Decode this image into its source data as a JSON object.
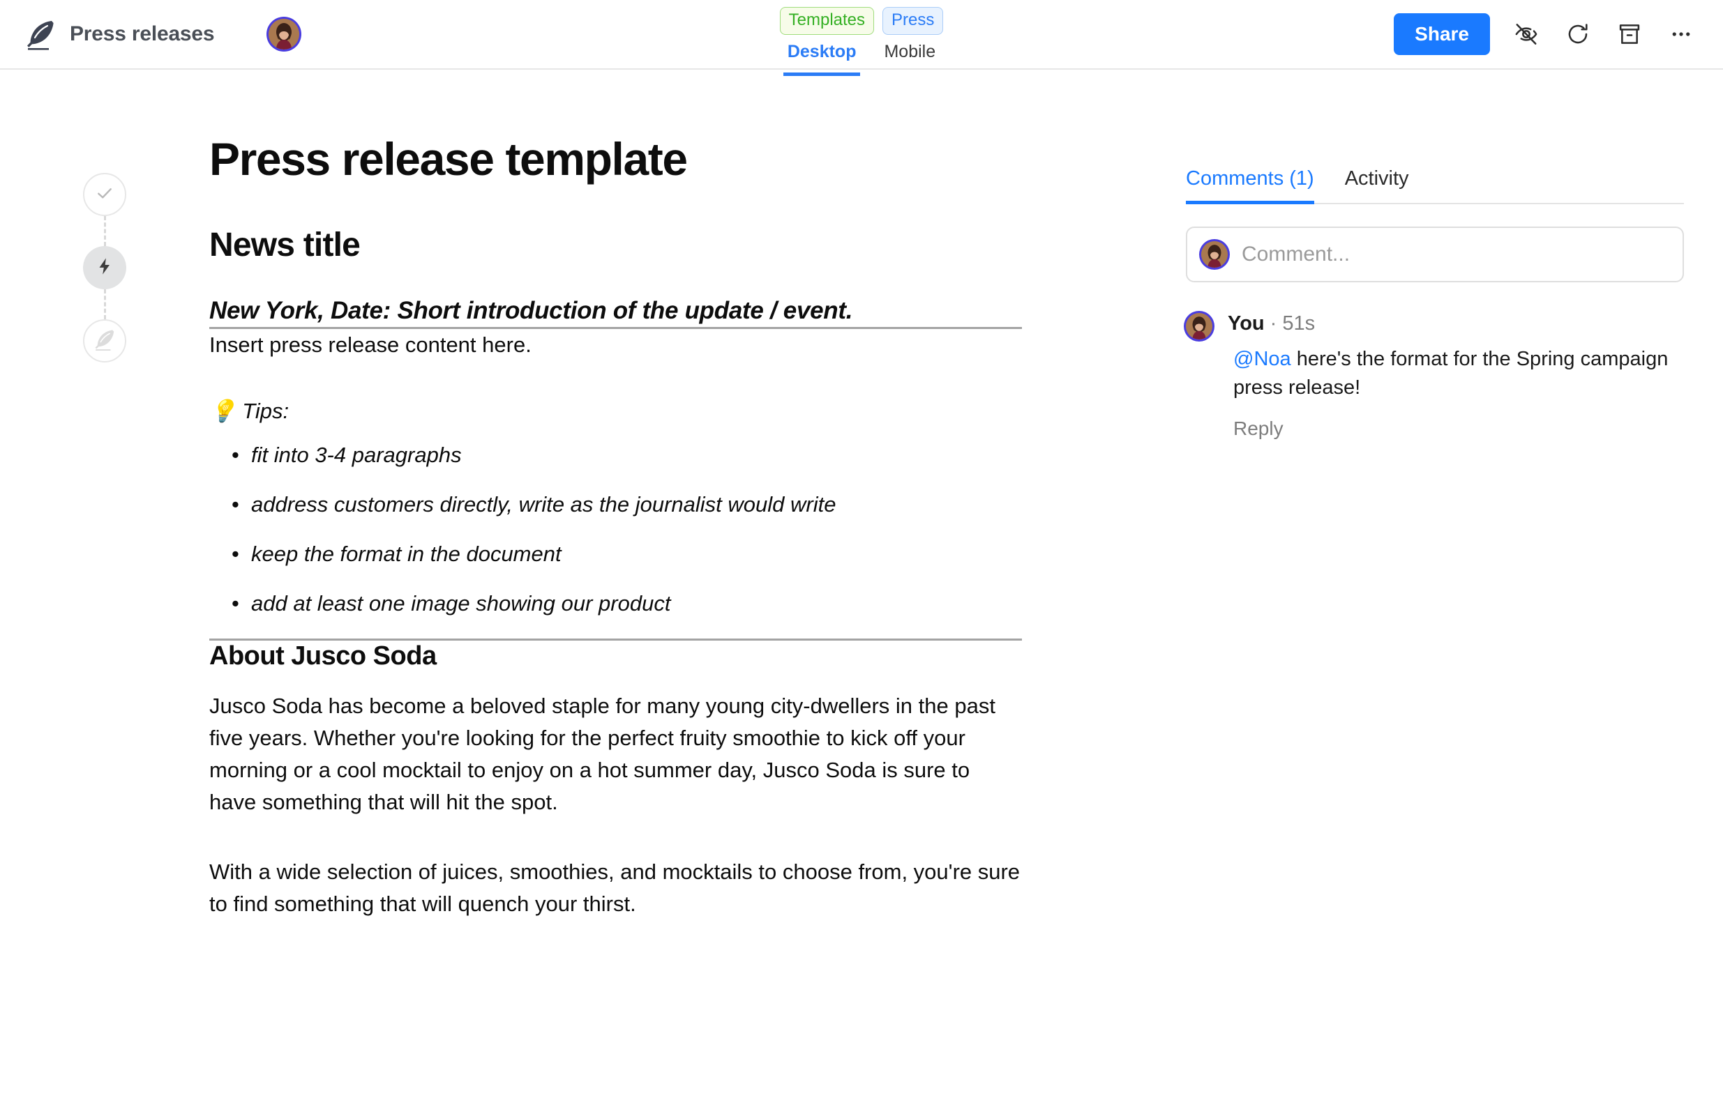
{
  "header": {
    "logo_icon": "feather-quill-icon",
    "title": "Press releases",
    "avatar_name": "user-avatar",
    "tags": [
      {
        "label": "Templates",
        "color": "#35b024",
        "bg": "#f7fce9",
        "border": "#9fdc7c"
      },
      {
        "label": "Press",
        "color": "#2b7cf6",
        "bg": "#e8f2fe",
        "border": "#aacdf8"
      }
    ],
    "view_tabs": [
      {
        "label": "Desktop",
        "active": true
      },
      {
        "label": "Mobile",
        "active": false
      }
    ],
    "share_label": "Share",
    "actions": [
      {
        "icon": "eye-off-icon"
      },
      {
        "icon": "refresh-icon"
      },
      {
        "icon": "archive-icon"
      },
      {
        "icon": "more-horizontal-icon"
      }
    ],
    "accent_color": "#1a7aff"
  },
  "rail": {
    "steps": [
      {
        "icon": "check-icon",
        "state": "outlined"
      },
      {
        "icon": "lightning-bolt-icon",
        "state": "filled"
      },
      {
        "icon": "feather-quill-icon",
        "state": "outlined"
      }
    ]
  },
  "document": {
    "title": "Press release template",
    "heading_news": "News title",
    "intro": "New York, Date: Short introduction of the update / event.",
    "content_placeholder": "Insert press release content here.",
    "tips_emoji": "💡",
    "tips_label": "Tips:",
    "tips": [
      "fit into 3-4 paragraphs",
      "address customers directly, write as the journalist would write",
      "keep the format in the document",
      "add at least one image showing our product"
    ],
    "about_heading": "About Jusco Soda",
    "about_paragraph_1": "Jusco Soda has become a beloved staple for many young city-dwellers in the past five years. Whether you're looking for the perfect fruity smoothie to kick off your morning or a cool mocktail to enjoy on a hot summer day, Jusco Soda is sure to have something that will hit the spot.",
    "about_paragraph_2": "With a wide selection of juices, smoothies, and mocktails to choose from, you're sure to find something that will quench your thirst."
  },
  "comments": {
    "tabs": [
      {
        "label": "Comments (1)",
        "active": true
      },
      {
        "label": "Activity",
        "active": false
      }
    ],
    "input_placeholder": "Comment...",
    "items": [
      {
        "author": "You",
        "time": "· 51s",
        "mention": "@Noa",
        "text": " here's the format for the Spring campaign press release!",
        "reply_label": "Reply"
      }
    ]
  }
}
